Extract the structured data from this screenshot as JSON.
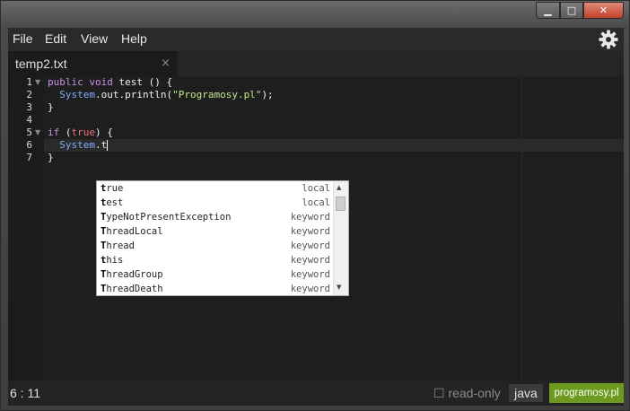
{
  "window": {
    "min_glyph": "▁",
    "max_glyph": "□",
    "close_glyph": "✕"
  },
  "menu": {
    "items": [
      "File",
      "Edit",
      "View",
      "Help"
    ]
  },
  "tab": {
    "label": "temp2.txt",
    "close_glyph": "×"
  },
  "gutter": {
    "lines": [
      "1",
      "2",
      "3",
      "4",
      "5",
      "6",
      "7"
    ]
  },
  "code": {
    "l1": {
      "kw": "public void",
      "rest": " test () {"
    },
    "l2": {
      "cls": "System",
      "mid": ".out.println(",
      "str": "\"Programosy.pl\"",
      "end": ");"
    },
    "l3": "}",
    "l5": {
      "kw": "if",
      "open": " (",
      "bool": "true",
      "close": ") {"
    },
    "l6": {
      "cls": "System",
      "rest": ".t"
    },
    "l7": "}"
  },
  "autocomplete": {
    "items": [
      {
        "m": "t",
        "r": "rue",
        "kind": "local"
      },
      {
        "m": "t",
        "r": "est",
        "kind": "local"
      },
      {
        "m": "T",
        "r": "ypeNotPresentException",
        "kind": "keyword"
      },
      {
        "m": "T",
        "r": "hreadLocal",
        "kind": "keyword"
      },
      {
        "m": "T",
        "r": "hread",
        "kind": "keyword"
      },
      {
        "m": "t",
        "r": "his",
        "kind": "keyword"
      },
      {
        "m": "T",
        "r": "hreadGroup",
        "kind": "keyword"
      },
      {
        "m": "T",
        "r": "hreadDeath",
        "kind": "keyword"
      }
    ]
  },
  "status": {
    "position": "6 : 11",
    "readonly_label": "☐ read-only",
    "language": "java",
    "brand": "programosy.pl"
  },
  "colors": {
    "keyword": "#c792ea",
    "class": "#82aaff",
    "string": "#c3e88d",
    "boolean": "#f07178",
    "brand": "#6b9a1e"
  }
}
